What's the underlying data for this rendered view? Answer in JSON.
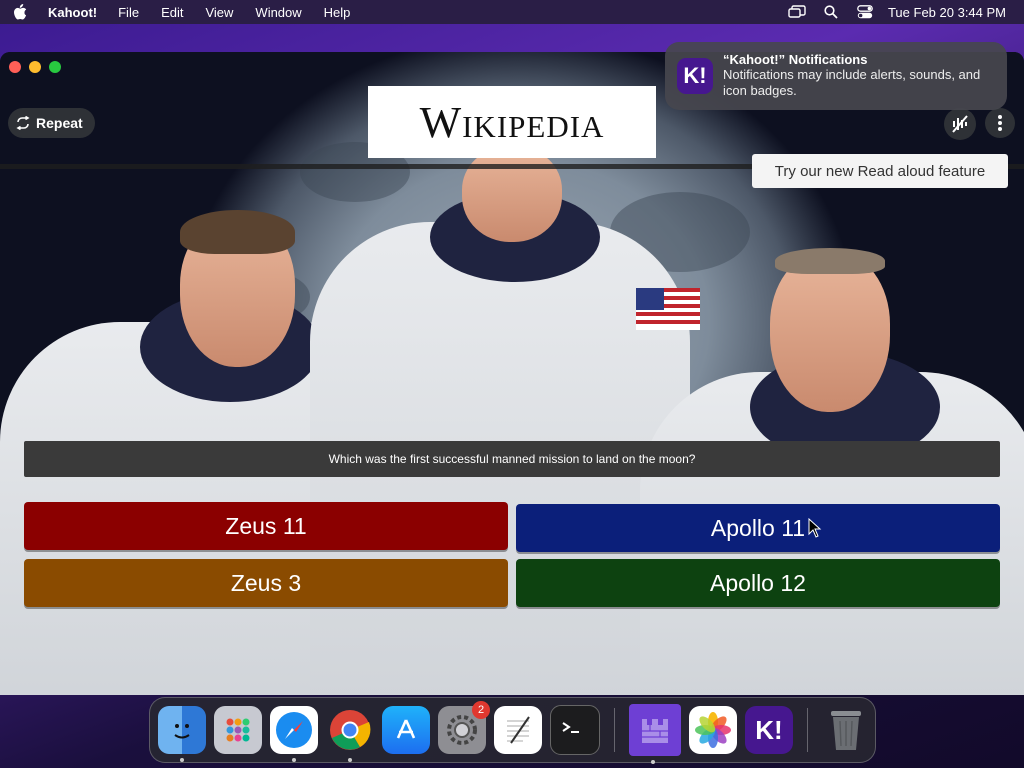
{
  "menubar": {
    "app_name": "Kahoot!",
    "menus": [
      "File",
      "Edit",
      "View",
      "Window",
      "Help"
    ],
    "clock": "Tue Feb 20  3:44 PM"
  },
  "window": {
    "repeat_label": "Repeat",
    "logo_text": "Wikipedia",
    "tooltip": "Try our new Read aloud feature"
  },
  "quiz": {
    "question": "Which was the first successful manned mission to land on the moon?",
    "answers": [
      {
        "label": "Zeus 11",
        "color": "#8b0000"
      },
      {
        "label": "Apollo 11",
        "color": "#0b1f7a"
      },
      {
        "label": "Zeus 3",
        "color": "#8a4b00"
      },
      {
        "label": "Apollo 12",
        "color": "#0d4210"
      }
    ]
  },
  "notification": {
    "title": "“Kahoot!” Notifications",
    "body": "Notifications may include alerts, sounds, and icon badges.",
    "icon_text": "K!"
  },
  "dock": {
    "apps": [
      "Finder",
      "Launchpad",
      "Safari",
      "Chrome",
      "App Store",
      "System Settings",
      "TextEdit",
      "Terminal",
      "Kahoot App",
      "Photos",
      "Kahoot!",
      "Trash"
    ],
    "settings_badge": "2",
    "kahoot_icon_text": "K!"
  }
}
